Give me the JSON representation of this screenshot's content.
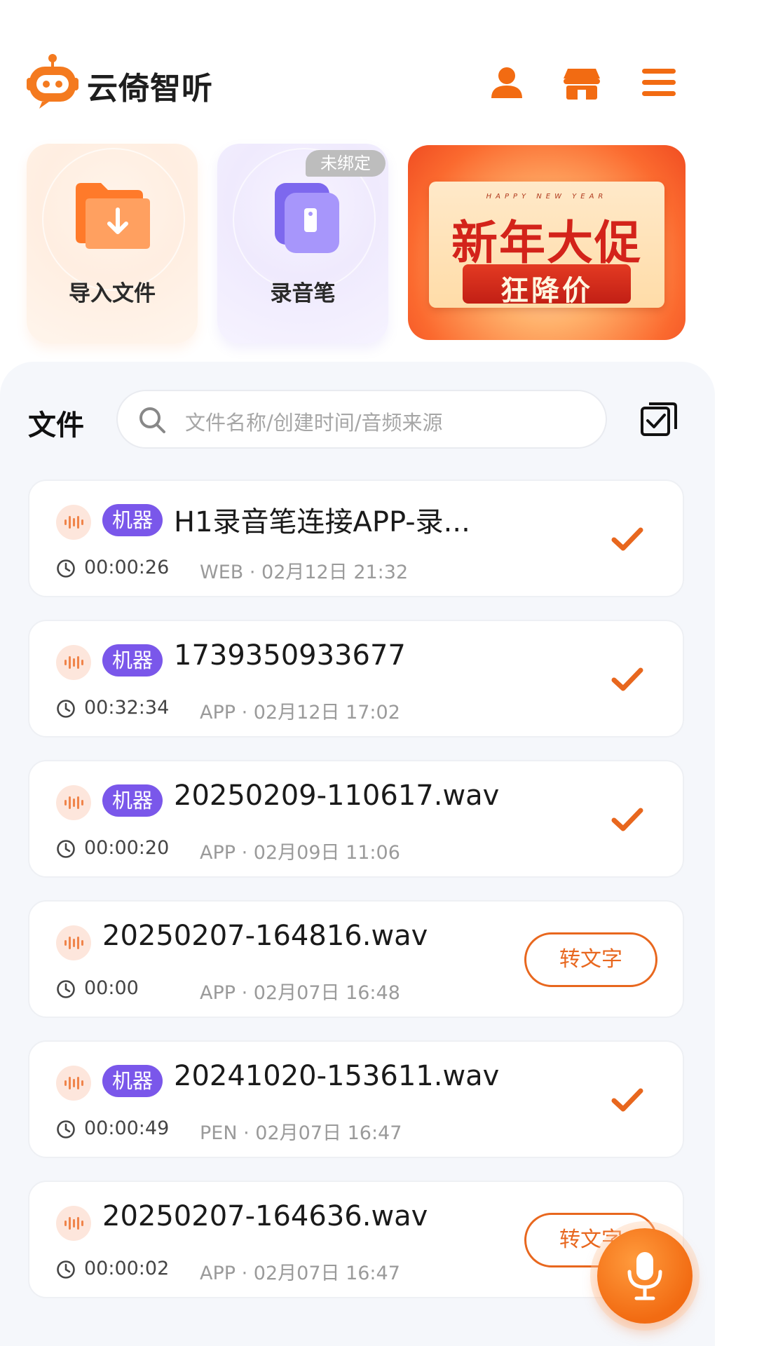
{
  "app": {
    "title": "云倚智听"
  },
  "header": {
    "icons": [
      "user-icon",
      "store-icon",
      "menu-icon"
    ]
  },
  "quick_actions": {
    "import_label": "导入文件",
    "pen_label": "录音笔",
    "pen_badge": "未绑定"
  },
  "promo": {
    "happy_new_year": "HAPPY NEW YEAR",
    "title": "新年大促",
    "subtitle": "狂降价"
  },
  "files": {
    "title": "文件",
    "search_placeholder": "文件名称/创建时间/音频来源",
    "items": [
      {
        "tag": "机器",
        "name": "H1录音笔连接APP-录...",
        "duration": "00:00:26",
        "meta": "WEB · 02月12日 21:32",
        "status": "done"
      },
      {
        "tag": "机器",
        "name": "1739350933677",
        "duration": "00:32:34",
        "meta": "APP · 02月12日 17:02",
        "status": "done"
      },
      {
        "tag": "机器",
        "name": "20250209-110617.wav",
        "duration": "00:00:20",
        "meta": "APP · 02月09日 11:06",
        "status": "done"
      },
      {
        "tag": "",
        "name": "20250207-164816.wav",
        "duration": "00:00",
        "meta": "APP · 02月07日 16:48",
        "status": "transcribe",
        "action": "转文字"
      },
      {
        "tag": "机器",
        "name": "20241020-153611.wav",
        "duration": "00:00:49",
        "meta": "PEN · 02月07日 16:47",
        "status": "done"
      },
      {
        "tag": "",
        "name": "20250207-164636.wav",
        "duration": "00:00:02",
        "meta": "APP · 02月07日 16:47",
        "status": "transcribe",
        "action": "转文字"
      }
    ]
  },
  "colors": {
    "accent": "#F26B12",
    "tag_purple": "#7A57EA",
    "panel_bg": "#F5F7FB"
  }
}
